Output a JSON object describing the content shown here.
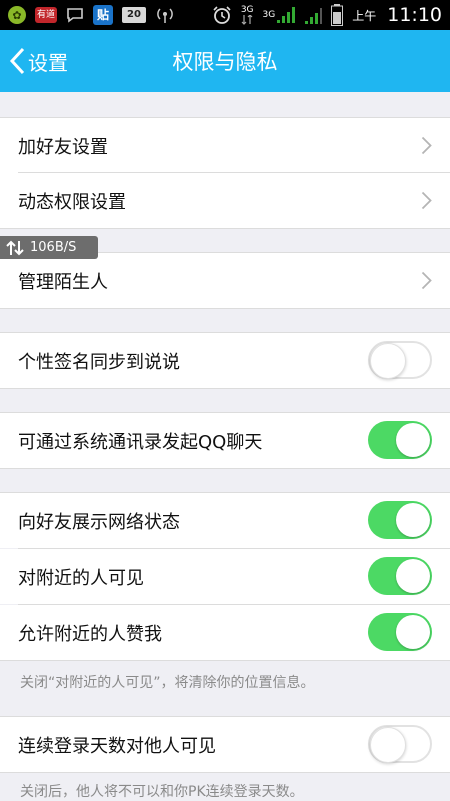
{
  "status_bar": {
    "app_icons": [
      "green-app-icon",
      "red-app-icon",
      "chat-bubble-icon",
      "tieba-icon",
      "20-app-icon",
      "wifi-antenna-icon"
    ],
    "badge_red_text": "有道",
    "badge_blue_text": "贴",
    "badge_grey_text": "20",
    "network_1": "3G",
    "network_2": "3G",
    "ampm": "上午",
    "time": "11:10"
  },
  "header": {
    "back_label": "设置",
    "title": "权限与隐私"
  },
  "rows": {
    "add_friend": "加好友设置",
    "feed_permission": "动态权限设置",
    "manage_strangers": "管理陌生人",
    "signature_sync": "个性签名同步到说说",
    "contacts_chat": "可通过系统通讯录发起QQ聊天",
    "show_network": "向好友展示网络状态",
    "nearby_visible": "对附近的人可见",
    "nearby_like": "允许附近的人赞我",
    "login_days": "连续登录天数对他人可见"
  },
  "toggles": {
    "signature_sync": false,
    "contacts_chat": true,
    "show_network": true,
    "nearby_visible": true,
    "nearby_like": true,
    "login_days": false
  },
  "notes": {
    "nearby_note": "关闭“对附近的人可见”，将清除你的位置信息。",
    "login_note": "关闭后，他人将不可以和你PK连续登录天数。"
  },
  "speed_badge": "106B/S",
  "colors": {
    "header": "#1fb6f1",
    "toggle_on": "#4cd964",
    "background": "#efeff4"
  }
}
